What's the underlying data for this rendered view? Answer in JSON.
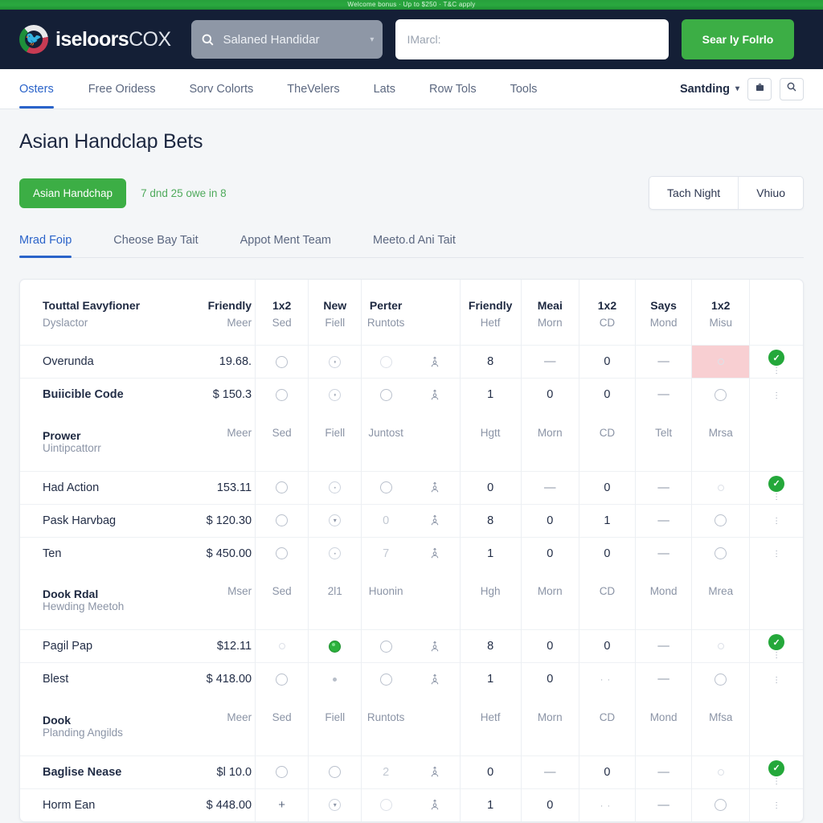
{
  "promo": {
    "text": "Welcome bonus  ·  Up to $250  ·  T&C apply"
  },
  "brand": {
    "primary": "iseloors",
    "secondary": "COX",
    "mark_icon": "bird-logo-icon"
  },
  "header": {
    "scope_search": {
      "placeholder": "Salaned Handidar",
      "icon": "search-icon",
      "caret": "chevron-down-icon"
    },
    "query": {
      "placeholder": "IMarcl:",
      "value": ""
    },
    "submit_label": "Sear ly Folrlo"
  },
  "nav": {
    "items": [
      {
        "label": "Osters",
        "active": true
      },
      {
        "label": "Free Oridess",
        "active": false
      },
      {
        "label": "Sorv Colorts",
        "active": false
      },
      {
        "label": "TheVelers",
        "active": false
      },
      {
        "label": "Lats",
        "active": false
      },
      {
        "label": "Row Tols",
        "active": false
      },
      {
        "label": "Tools",
        "active": false
      }
    ],
    "account_label": "Santding",
    "account_chevron": "chevron-down-icon",
    "briefcase_icon": "briefcase-icon",
    "search_icon": "search-icon"
  },
  "page": {
    "title": "Asian Handclap Bets",
    "badge": "Asian Handchap",
    "meta_note": "7 dnd 25 owe in 8",
    "segmented": [
      {
        "label": "Tach Night"
      },
      {
        "label": "Vhiuo"
      }
    ],
    "subtabs": [
      {
        "label": "Mrad Foip",
        "active": true
      },
      {
        "label": "Cheose Bay Tait",
        "active": false
      },
      {
        "label": "Appot Ment Team",
        "active": false
      },
      {
        "label": "Meeto.d Ani Tait",
        "active": false
      }
    ]
  },
  "table": {
    "header_main": [
      "Touttal Eavyfioner",
      "Friendly",
      "1x2",
      "New",
      "Perter",
      "",
      "Friendly",
      "Meai",
      "1x2",
      "Says",
      "1x2",
      ""
    ],
    "groups": [
      {
        "title": "",
        "sub": [
          "Dyslactor",
          "Meer",
          "Sed",
          "Fiell",
          "Runtots",
          "",
          "Hetf",
          "Morn",
          "CD",
          "Mond",
          "Misu",
          ""
        ],
        "rows": [
          {
            "name": "Overunda",
            "strong": false,
            "amount": "19.68.",
            "s1": "ring",
            "s2": "ring-dotted",
            "s3": "ring-faint",
            "s3b": "person",
            "n1": "8",
            "n2": "—",
            "n3": "0",
            "n4": "—",
            "n5": "ring-faint-small",
            "n5_highlight": true,
            "status": "check"
          },
          {
            "name": "Buiicible Code",
            "strong": true,
            "amount": "$ 150.3",
            "s1": "ring",
            "s2": "ring-dotted",
            "s3": "ring",
            "s3b": "person",
            "n1": "1",
            "n2": "0",
            "n3": "0",
            "n4": "—",
            "n5": "ring",
            "n5_highlight": false,
            "status": "kebab"
          }
        ]
      },
      {
        "title": "Prower",
        "sub": [
          "Uintipcattorr",
          "Meer",
          "Sed",
          "Fiell",
          "Juntost",
          "",
          "Hgtt",
          "Morn",
          "CD",
          "Telt",
          "Mrsa",
          ""
        ],
        "rows": [
          {
            "name": "Had Action",
            "strong": false,
            "amount": "153.11",
            "s1": "ring",
            "s2": "ring-dotted",
            "s3": "ring",
            "s3b": "person",
            "n1": "0",
            "n2": "—",
            "n3": "0",
            "n4": "—",
            "n5": "ring-faint-small",
            "n5_highlight": false,
            "status": "check"
          },
          {
            "name": "Pask Harvbag",
            "strong": false,
            "amount": "$ 120.30",
            "s1": "ring",
            "s2": "chev",
            "s3": "0",
            "s3b": "person",
            "n1": "8",
            "n2": "0",
            "n3": "1",
            "n4": "—",
            "n5": "ring",
            "n5_highlight": false,
            "status": "kebab"
          },
          {
            "name": "Ten",
            "strong": false,
            "amount": "$ 450.00",
            "s1": "ring",
            "s2": "ring-dotted",
            "s3": "7",
            "s3b": "person",
            "n1": "1",
            "n2": "0",
            "n3": "0",
            "n4": "—",
            "n5": "ring",
            "n5_highlight": false,
            "status": "kebab"
          }
        ]
      },
      {
        "title": "Dook Rdal",
        "sub": [
          "Hewding Meetoh",
          "Mser",
          "Sed",
          "2l1",
          "Huonin",
          "",
          "Hgh",
          "Morn",
          "CD",
          "Mond",
          "Mrea",
          ""
        ],
        "rows": [
          {
            "name": "Pagil Pap",
            "strong": false,
            "amount": "$12.11",
            "s1": "ring-faint-small",
            "s2": "ring-filled",
            "s3": "ring",
            "s3b": "person",
            "n1": "8",
            "n2": "0",
            "n3": "0",
            "n4": "—",
            "n5": "ring-faint-small",
            "n5_highlight": false,
            "status": "check"
          },
          {
            "name": "Blest",
            "strong": false,
            "amount": "$ 418.00",
            "s1": "ring",
            "s2": "dot-small",
            "s3": "ring",
            "s3b": "person",
            "n1": "1",
            "n2": "0",
            "n3": "· ·",
            "n4": "—",
            "n5": "ring",
            "n5_highlight": false,
            "status": "kebab"
          }
        ]
      },
      {
        "title": "Dook",
        "sub": [
          "Planding Angilds",
          "Meer",
          "Sed",
          "Fiell",
          "Runtots",
          "",
          "Hetf",
          "Morn",
          "CD",
          "Mond",
          "Mfsa",
          ""
        ],
        "rows": [
          {
            "name": "Baglise Nease",
            "strong": true,
            "amount": "$l 10.0",
            "s1": "ring",
            "s2": "ring",
            "s3": "2",
            "s3b": "person",
            "n1": "0",
            "n2": "—",
            "n3": "0",
            "n4": "—",
            "n5": "ring-faint-small",
            "n5_highlight": false,
            "status": "check"
          },
          {
            "name": "Horm Ean",
            "strong": false,
            "amount": "$ 448.00",
            "s1": "plus",
            "s2": "chev",
            "s3": "ring-faint",
            "s3b": "person",
            "n1": "1",
            "n2": "0",
            "n3": "· ·",
            "n4": "—",
            "n5": "ring",
            "n5_highlight": false,
            "status": "kebab"
          }
        ]
      }
    ]
  },
  "colors": {
    "brand_dark": "#141f36",
    "green": "#3cae45",
    "accent_blue": "#2a63c9",
    "highlight_pink": "#f8cfd2",
    "check_green": "#24a83a"
  }
}
